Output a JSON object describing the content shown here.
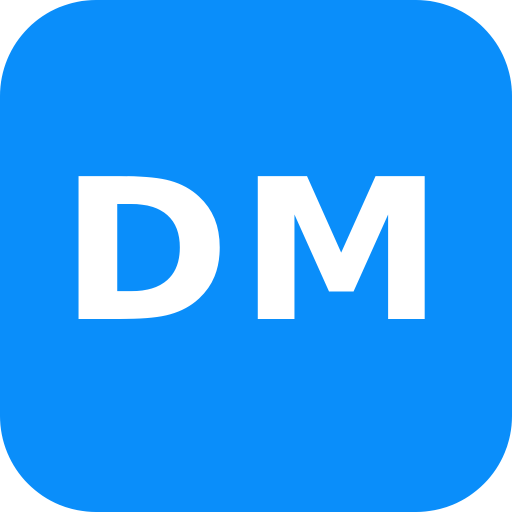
{
  "icon": {
    "label": "DM",
    "background_color": "#0a8efa",
    "text_color": "#ffffff"
  }
}
